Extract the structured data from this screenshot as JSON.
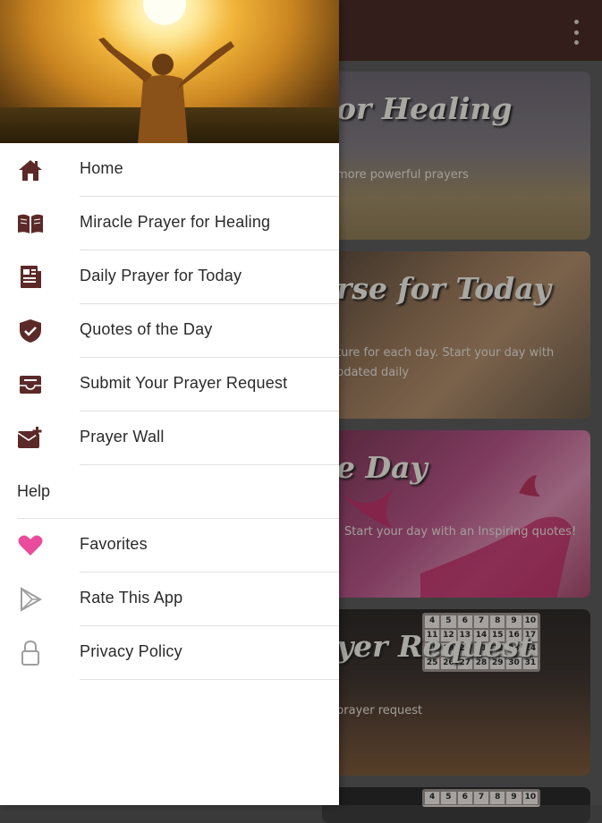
{
  "appbar": {
    "overflow_icon": "more-vert-icon"
  },
  "cards": [
    {
      "title": "or Healing",
      "subtitle": "more powerful prayers"
    },
    {
      "title": "rse for Today",
      "subtitle_line1": "ture for each day. Start your day with",
      "subtitle_line2": "pdated daily"
    },
    {
      "title": "e Day",
      "subtitle": "Start your day with an Inspiring quotes!"
    },
    {
      "title": "yer Request",
      "subtitle": "prayer request"
    }
  ],
  "calendar_days": [
    "4",
    "5",
    "6",
    "7",
    "8",
    "9",
    "10",
    "11",
    "12",
    "13",
    "14",
    "15",
    "16",
    "17",
    "18",
    "19",
    "20",
    "21",
    "22",
    "23",
    "24",
    "25",
    "26",
    "27",
    "28",
    "29",
    "30",
    "31"
  ],
  "calendar_days_bottom": [
    "4",
    "5",
    "6",
    "7",
    "8",
    "9",
    "10"
  ],
  "drawer": {
    "menu": [
      {
        "label": "Home",
        "icon": "home-icon"
      },
      {
        "label": "Miracle Prayer for Healing",
        "icon": "book-icon"
      },
      {
        "label": "Daily Prayer for Today",
        "icon": "news-icon"
      },
      {
        "label": "Quotes of the Day",
        "icon": "shield-check-icon"
      },
      {
        "label": "Submit Your Prayer Request",
        "icon": "inbox-icon"
      },
      {
        "label": "Prayer Wall",
        "icon": "mail-add-icon"
      }
    ],
    "section_label": "Help",
    "help": [
      {
        "label": "Favorites",
        "icon": "heart-icon"
      },
      {
        "label": "Rate This App",
        "icon": "play-store-icon"
      },
      {
        "label": "Privacy Policy",
        "icon": "lock-icon"
      }
    ]
  },
  "colors": {
    "appbar": "#4a2b27",
    "icon": "#5b2a28",
    "heart": "#e94c9a",
    "muted_icon": "#9e9e9e"
  }
}
